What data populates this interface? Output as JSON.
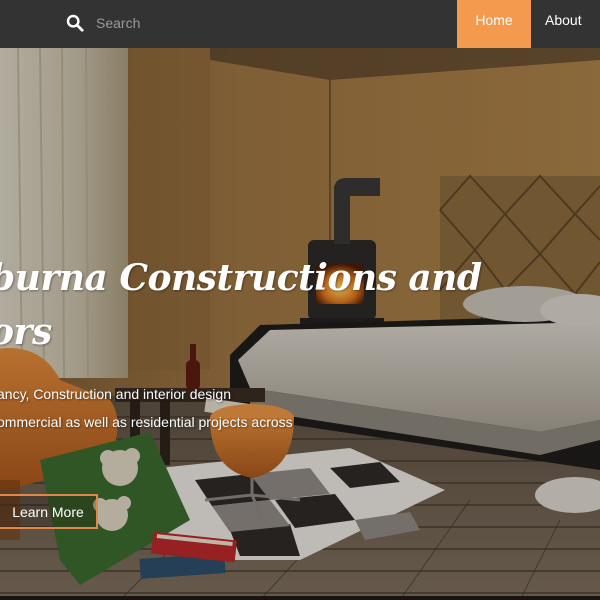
{
  "search": {
    "icon": "search-icon",
    "placeholder": "Search"
  },
  "nav": {
    "home_label": "Home",
    "about_label": "About",
    "active_color": "#f39a4f"
  },
  "hero": {
    "title_line1": "burna Constructions and",
    "title_line2": "ors",
    "desc_line1": "ltancy, Construction and interior design",
    "desc_line2": "commercial as well as residential projects across",
    "cta_label": "Learn More",
    "cta_border_color": "#e0884a"
  },
  "colors": {
    "topbar": "#333333",
    "wall": "#a57b46"
  }
}
